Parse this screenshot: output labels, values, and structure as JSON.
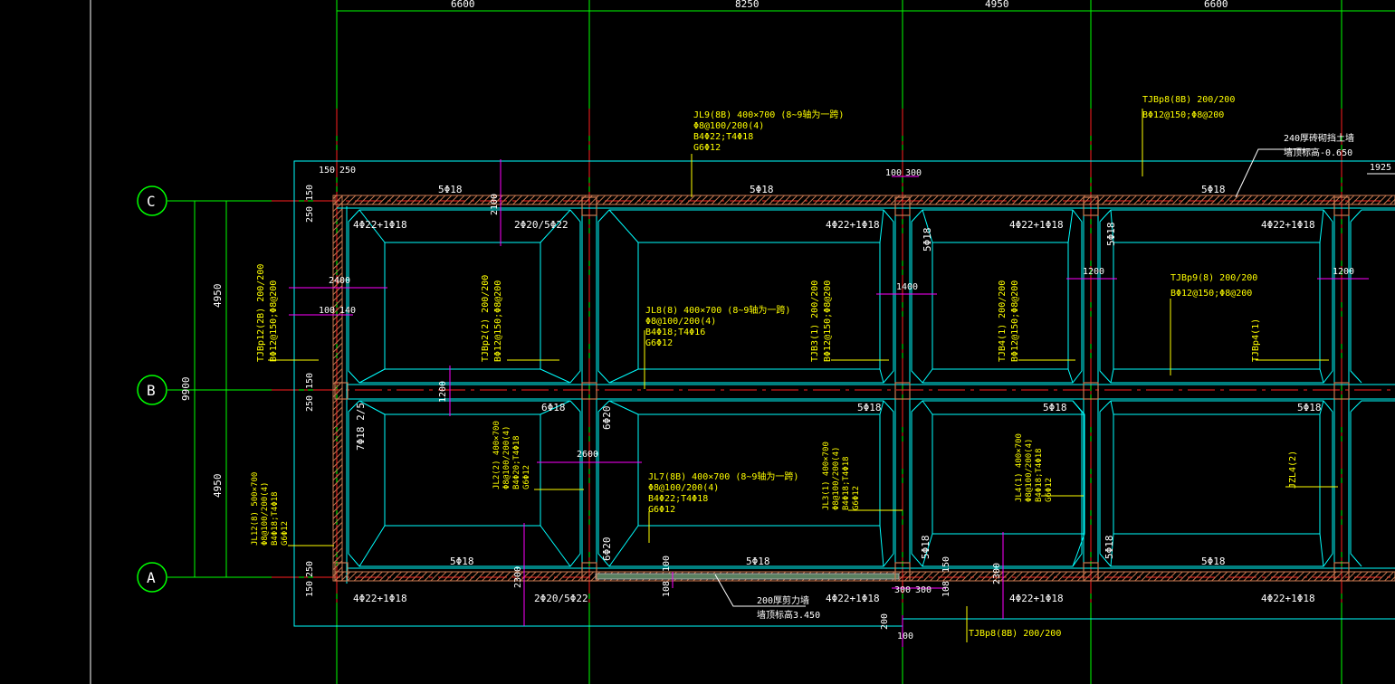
{
  "colors": {
    "background": "#000000",
    "grid": "#00ff00",
    "axis": "#ff2020",
    "beam": "#00ffff",
    "dimension": "#ff00ff",
    "text_white": "#ffffff",
    "text_yellow": "#ffff00",
    "wall": "#c87850"
  },
  "dims_top": [
    "6600",
    "8250",
    "4950",
    "6600"
  ],
  "dims_left": {
    "upper": "4950",
    "lower": "4950",
    "total": "9900"
  },
  "axes": [
    "C",
    "B",
    "A"
  ],
  "small_dims": {
    "c150_top": "150",
    "c250_top": "250",
    "c100": "100",
    "c300": "300",
    "c1925": "1925",
    "c250_v": "250",
    "c150_v": "150",
    "b150": "150",
    "b250": "250",
    "a250": "250",
    "a150": "150",
    "d2100": "2100",
    "d2400": "2400",
    "d100": "100",
    "d140": "140",
    "d1200_a": "1200",
    "d1400": "1400",
    "d1200_b": "1200",
    "d1200_c": "1200",
    "d2600": "2600",
    "d2300_a": "2300",
    "d2300_b": "2300",
    "d100_bot": "100",
    "d108": "108",
    "d300_l": "300",
    "d300_r": "300",
    "d108_r": "108",
    "d150_r": "150",
    "d200": "200",
    "d100_low": "100"
  },
  "reinf": {
    "c_top_1": "5Φ18",
    "c_top_2": "5Φ18",
    "c_top_3": "5Φ18",
    "c_in_1": "4Φ22+1Φ18",
    "c_in_2": "2Φ20/5Φ22",
    "c_in_3": "4Φ22+1Φ18",
    "c_in_4": "4Φ22+1Φ18",
    "c_in_5": "4Φ22+1Φ18",
    "b_1": "6Φ18",
    "b_2": "5Φ18",
    "b_3": "5Φ18",
    "b_4": "5Φ18",
    "a_1": "5Φ18",
    "a_2": "5Φ18",
    "a_3": "5Φ18",
    "a_out_1": "4Φ22+1Φ18",
    "a_out_2": "2Φ20/5Φ22",
    "a_out_3": "4Φ22+1Φ18",
    "a_out_4": "4Φ22+1Φ18",
    "a_out_5": "4Φ22+1Φ18",
    "v_1": "5Φ18",
    "v_2": "5Φ18",
    "v_3": "6Φ20",
    "v_4": "6Φ20",
    "v_5": "5Φ18",
    "v_6": "5Φ18",
    "v_7": "7Φ18 2/5"
  },
  "labels": {
    "jl9": [
      "JL9(8B) 400×700  (8~9轴为一跨)",
      "Φ8@100/200(4)",
      "B4Φ22;T4Φ18",
      "G6Φ12"
    ],
    "tjbp8_top": [
      "TJBp8(8B) 200/200",
      "BΦ12@150;Φ8@200"
    ],
    "wall_top": [
      "240厚砖砌挡土墙",
      "墙顶标高-0.650"
    ],
    "jl8": [
      "JL8(8) 400×700  (8~9轴为一跨)",
      "Φ8@100/200(4)",
      "B4Φ18;T4Φ16",
      "G6Φ12"
    ],
    "tjbp9": [
      "TJBp9(8) 200/200",
      "BΦ12@150;Φ8@200"
    ],
    "jl7": [
      "JL7(8B) 400×700  (8~9轴为一跨)",
      "Φ8@100/200(4)",
      "B4Φ22;T4Φ18",
      "G6Φ12"
    ],
    "wall_bot": [
      "200厚剪力墙",
      "墙顶标高3.450"
    ],
    "tjbp8_bot": "TJBp8(8B) 200/200",
    "tjbp12": [
      "TJBp12(2B) 200/200",
      "BΦ12@150;Φ8@200"
    ],
    "tjbp22": [
      "TJBp2(2) 200/200",
      "BΦ12@150;Φ8@200"
    ],
    "tjb31": [
      "TJB3(1) 200/200",
      "BΦ12@150;Φ8@200"
    ],
    "tjb41": [
      "TJB4(1) 200/200",
      "BΦ12@150;Φ8@200"
    ],
    "tjbp41": "TJBp4(1)",
    "jl12": [
      "JL12(8) 500×700",
      "Φ8@100/200(4)",
      "B4Φ18;T4Φ18",
      "G6Φ12"
    ],
    "jl2": [
      "JL2(2) 400×700",
      "Φ8@100/200(4)",
      "B4Φ20;T4Φ18",
      "G6Φ12"
    ],
    "jl3": [
      "JL3(1) 400×700",
      "Φ8@100/200(4)",
      "B4Φ18;T4Φ18",
      "G6Φ12"
    ],
    "jl4": [
      "JL4(1) 400×700",
      "Φ8@100/200(4)",
      "B4Φ18;T4Φ18",
      "G6Φ12"
    ],
    "jzl4": "JZL4(2)"
  }
}
